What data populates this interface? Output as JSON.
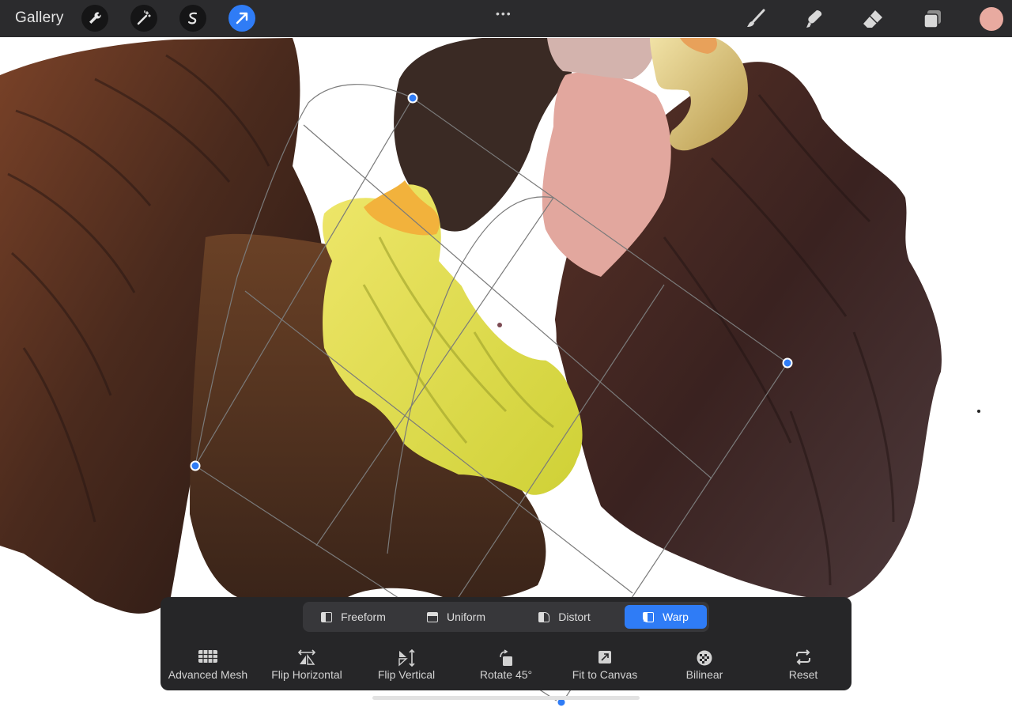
{
  "topbar": {
    "gallery_label": "Gallery",
    "left_tools": [
      {
        "icon": "wrench-icon",
        "name": "actions"
      },
      {
        "icon": "magic-wand-icon",
        "name": "adjustments"
      },
      {
        "icon": "selection-s-icon",
        "name": "selection"
      },
      {
        "icon": "transform-arrow-icon",
        "name": "transform",
        "active": true
      }
    ],
    "more_label": "•••",
    "right_tools": [
      {
        "icon": "brush-icon",
        "name": "brush"
      },
      {
        "icon": "smudge-icon",
        "name": "smudge"
      },
      {
        "icon": "eraser-icon",
        "name": "eraser"
      },
      {
        "icon": "layers-icon",
        "name": "layers"
      }
    ],
    "current_color": "#e8aaa0"
  },
  "transform": {
    "modes": [
      {
        "label": "Freeform",
        "icon": "freeform-icon"
      },
      {
        "label": "Uniform",
        "icon": "uniform-icon"
      },
      {
        "label": "Distort",
        "icon": "distort-icon"
      },
      {
        "label": "Warp",
        "icon": "warp-icon",
        "active": true
      }
    ],
    "actions": [
      {
        "label": "Advanced Mesh",
        "icon": "mesh-grid-icon"
      },
      {
        "label": "Flip Horizontal",
        "icon": "flip-horizontal-icon"
      },
      {
        "label": "Flip Vertical",
        "icon": "flip-vertical-icon"
      },
      {
        "label": "Rotate 45°",
        "icon": "rotate-icon"
      },
      {
        "label": "Fit to Canvas",
        "icon": "fit-canvas-icon"
      },
      {
        "label": "Bilinear",
        "icon": "bilinear-icon"
      },
      {
        "label": "Reset",
        "icon": "reset-icon"
      }
    ]
  },
  "colors": {
    "toolbar": "#2b2b2d",
    "accent": "#2f7cf6",
    "panel": "#262628",
    "feather_dark": "#2e1f1a",
    "feather_brown": "#6b3d25",
    "yellow_wing": "#e3e04a",
    "face": "#e2a79e",
    "beak": "#d9c27a"
  }
}
